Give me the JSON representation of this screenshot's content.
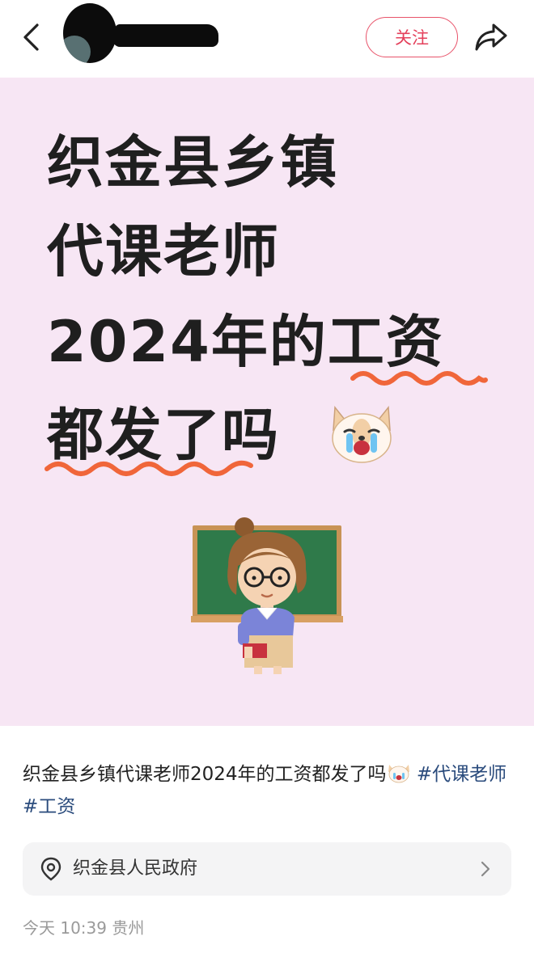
{
  "header": {
    "follow_label": "关注"
  },
  "poster": {
    "headline_lines": [
      "织金县乡镇",
      "代课老师",
      "2024年的工资",
      "都发了吗"
    ],
    "icons": {
      "emoji": "crying-dog-emoji",
      "illustration": "teacher-at-chalkboard"
    },
    "accent_underline_color": "#f0663a"
  },
  "post": {
    "caption_text": "织金县乡镇代课老师2024年的工资都发了吗",
    "tags": [
      "#代课老师",
      "#工资"
    ]
  },
  "location": {
    "label": "织金县人民政府",
    "icon": "location-pin-icon"
  },
  "meta": {
    "timestamp": "今天 10:39",
    "region": "贵州"
  }
}
